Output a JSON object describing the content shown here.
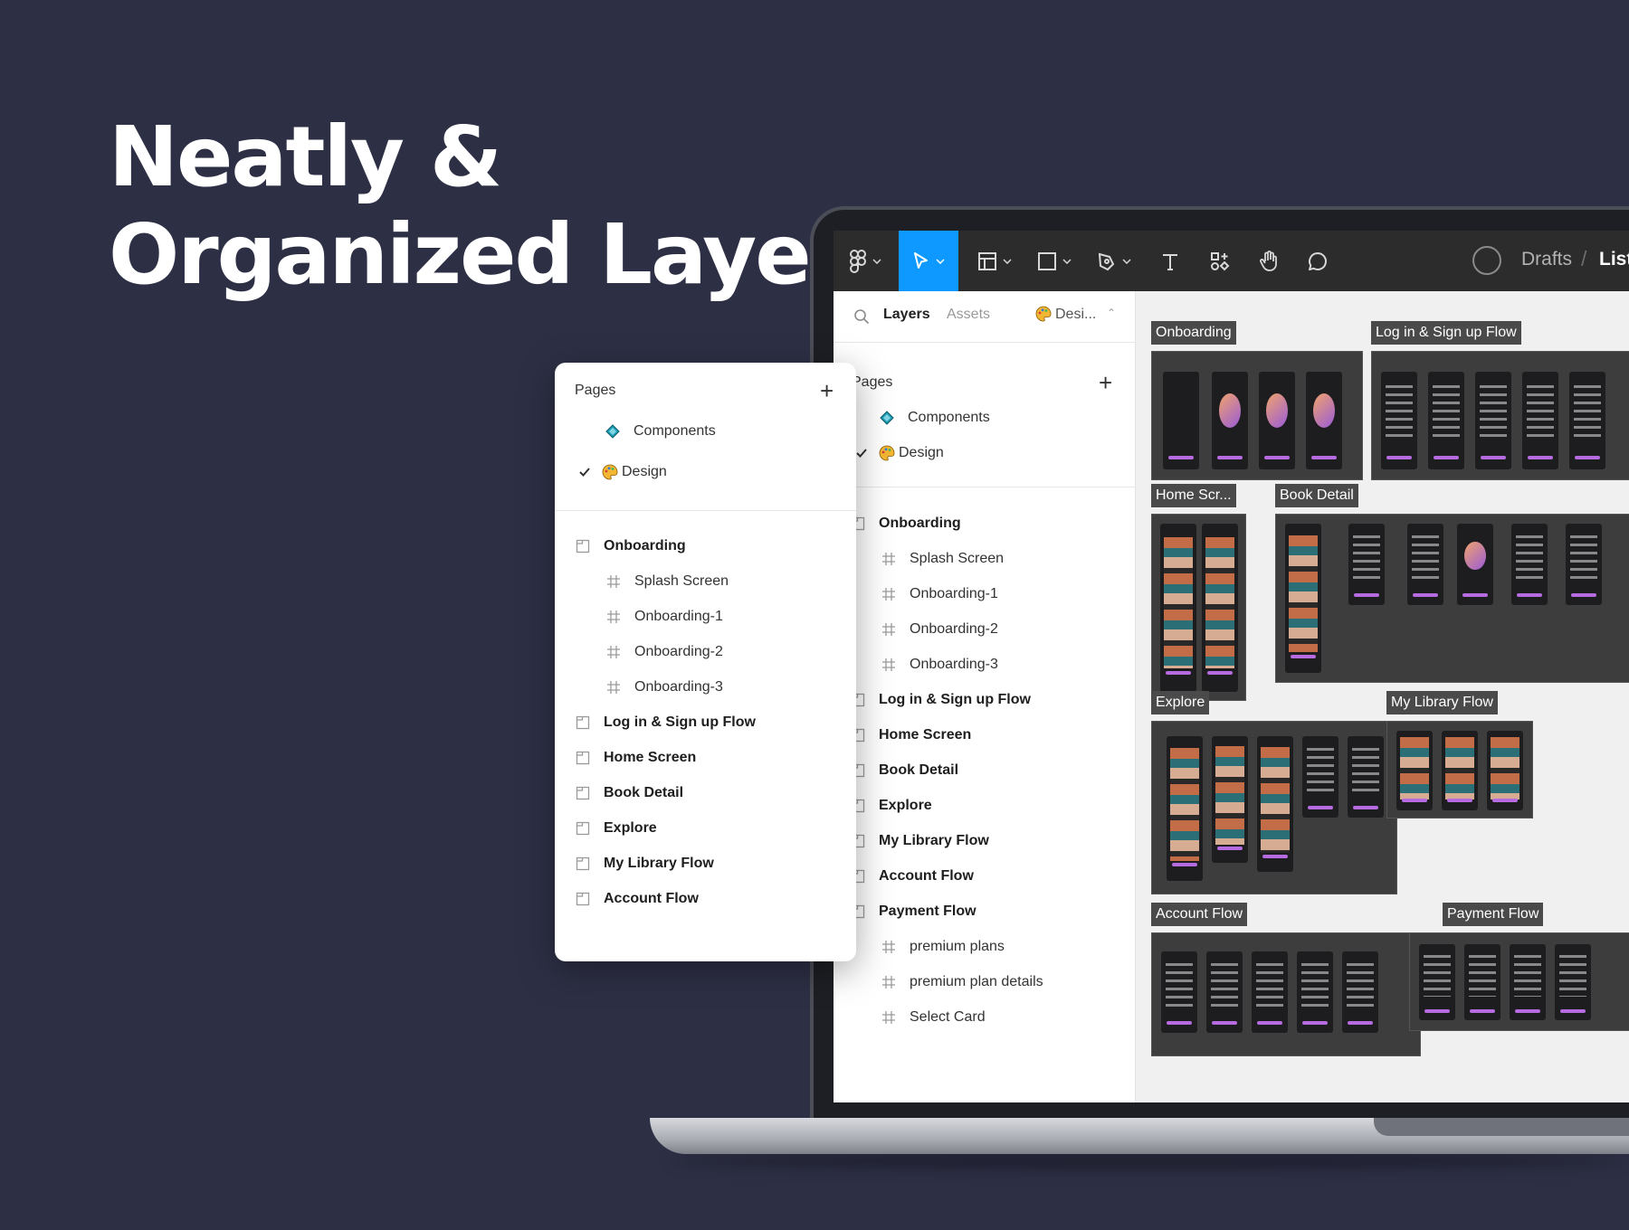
{
  "headline": {
    "line1": "Neatly &",
    "line2": "Organized Layer"
  },
  "toolbar": {
    "icons": [
      "figma-menu-icon",
      "move-tool-icon",
      "frame-tool-icon",
      "shape-tool-icon",
      "pen-tool-icon",
      "text-tool-icon",
      "resources-icon",
      "hand-tool-icon",
      "comment-icon"
    ],
    "active_tool": "move-tool-icon",
    "breadcrumb_location": "Drafts",
    "breadcrumb_separator": "/",
    "file_name": "List"
  },
  "left_panel": {
    "tabs": {
      "layers": "Layers",
      "assets": "Assets"
    },
    "current_page": "Desi...",
    "pages_title": "Pages",
    "pages": [
      {
        "label": "Components",
        "icon": "component-diamond-icon"
      },
      {
        "label": "Design",
        "icon": "palette-emoji-icon",
        "selected": true
      }
    ],
    "layers": [
      {
        "label": "Onboarding",
        "type": "section"
      },
      {
        "label": "Splash Screen",
        "type": "frame"
      },
      {
        "label": "Onboarding-1",
        "type": "frame"
      },
      {
        "label": "Onboarding-2",
        "type": "frame"
      },
      {
        "label": "Onboarding-3",
        "type": "frame"
      },
      {
        "label": "Log in & Sign up Flow",
        "type": "section"
      },
      {
        "label": "Home Screen",
        "type": "section"
      },
      {
        "label": "Book Detail",
        "type": "section"
      },
      {
        "label": "Explore",
        "type": "section"
      },
      {
        "label": "My Library Flow",
        "type": "section"
      },
      {
        "label": "Account Flow",
        "type": "section"
      },
      {
        "label": "Payment Flow",
        "type": "section"
      },
      {
        "label": "premium plans",
        "type": "frame"
      },
      {
        "label": "premium plan details",
        "type": "frame"
      },
      {
        "label": "Select Card",
        "type": "frame"
      }
    ]
  },
  "canvas": {
    "sections": [
      "Onboarding",
      "Log in & Sign up Flow",
      "Home Scr...",
      "Book Detail",
      "Explore",
      "My Library Flow",
      "Account Flow",
      "Payment Flow"
    ]
  },
  "card": {
    "pages_title": "Pages",
    "pages": [
      {
        "label": "Components",
        "icon": "component-diamond-icon"
      },
      {
        "label": "Design",
        "icon": "palette-emoji-icon",
        "selected": true
      }
    ],
    "layers": [
      {
        "label": "Onboarding",
        "type": "section"
      },
      {
        "label": "Splash Screen",
        "type": "frame"
      },
      {
        "label": "Onboarding-1",
        "type": "frame"
      },
      {
        "label": "Onboarding-2",
        "type": "frame"
      },
      {
        "label": "Onboarding-3",
        "type": "frame"
      },
      {
        "label": "Log in & Sign up Flow",
        "type": "section"
      },
      {
        "label": "Home Screen",
        "type": "section"
      },
      {
        "label": "Book Detail",
        "type": "section"
      },
      {
        "label": "Explore",
        "type": "section"
      },
      {
        "label": "My Library Flow",
        "type": "section"
      },
      {
        "label": "Account Flow",
        "type": "section"
      }
    ]
  },
  "colors": {
    "background": "#2d2f45",
    "toolbar": "#2c2c2c",
    "active_tool": "#0d99ff",
    "frame_label": "#4a4a4a",
    "accent_purple": "#b66be0"
  }
}
